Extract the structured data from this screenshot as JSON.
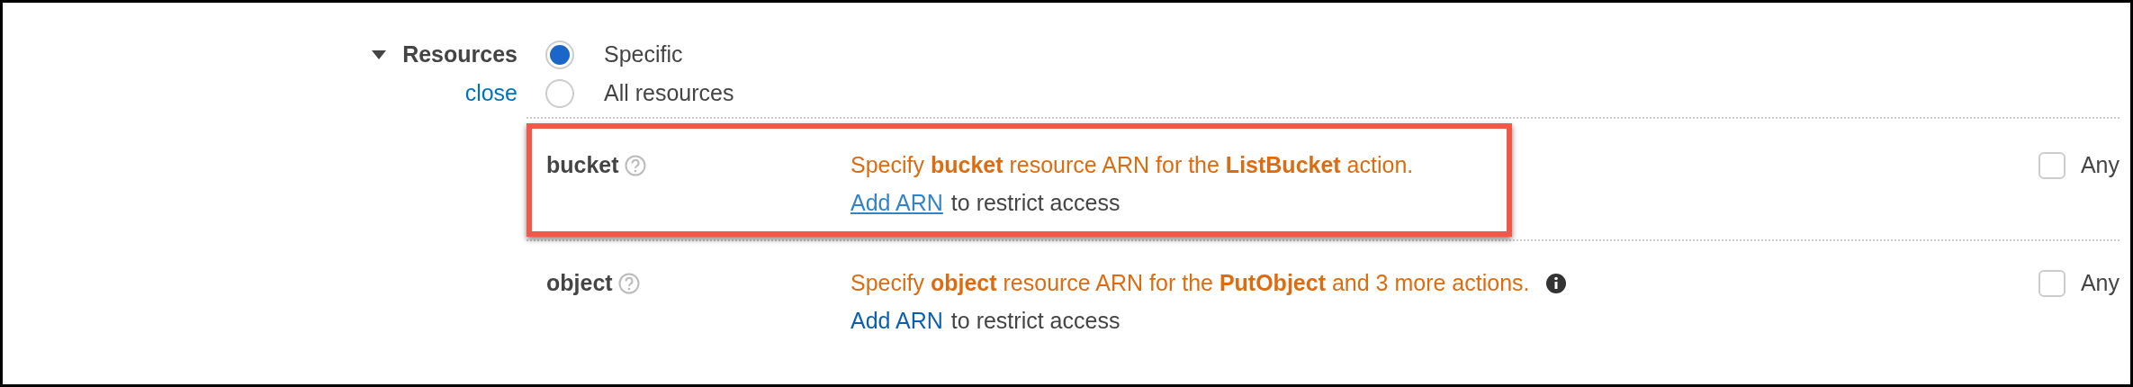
{
  "section": {
    "title": "Resources",
    "expanded": true,
    "close_link": "close",
    "options": [
      {
        "label": "Specific",
        "selected": true
      },
      {
        "label": "All resources",
        "selected": false
      }
    ]
  },
  "resources": [
    {
      "name": "bucket",
      "highlighted": true,
      "description": "Specify **bucket** resource ARN for the **ListBucket** action.",
      "info": false,
      "link": "Add ARN",
      "link_underlined": true,
      "link_suffix": "to restrict access",
      "any_label": "Any",
      "any_checked": false
    },
    {
      "name": "object",
      "highlighted": false,
      "description": "Specify **object** resource ARN for the **PutObject** and 3 more actions.",
      "info": true,
      "link": "Add ARN",
      "link_underlined": false,
      "link_suffix": "to restrict access",
      "any_label": "Any",
      "any_checked": false
    }
  ]
}
